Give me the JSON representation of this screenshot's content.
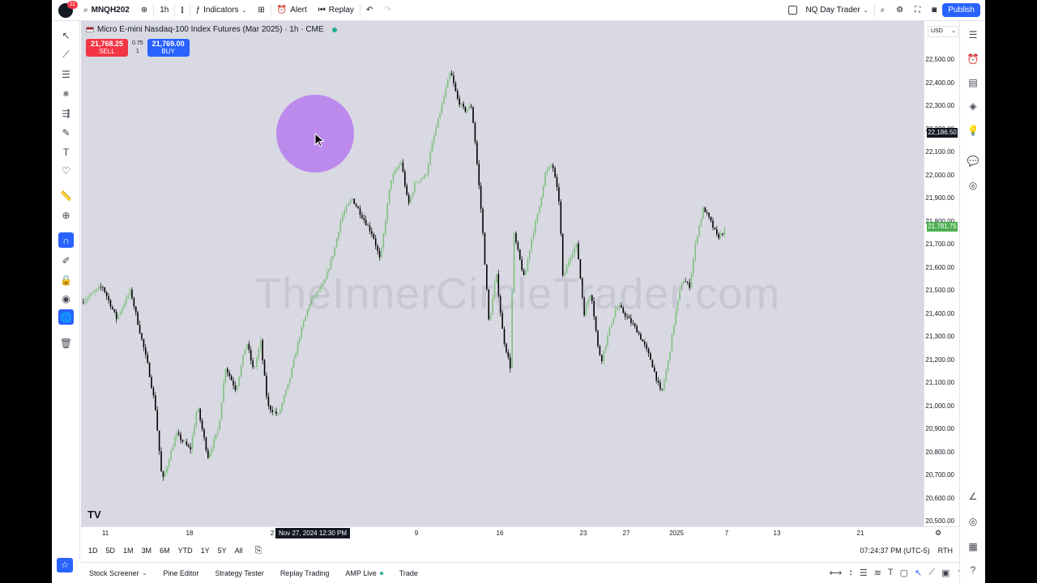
{
  "app": {
    "symbol": "MNQH202",
    "interval": "1h",
    "notifications": "11",
    "indicators_label": "Indicators",
    "alert_label": "Alert",
    "replay_label": "Replay",
    "layout_name": "NQ Day Trader",
    "publish_label": "Publish"
  },
  "chart": {
    "legend_title": "Micro E-mini Nasdaq-100 Index Futures (Mar 2025) · 1h · CME",
    "sell_price": "21,768.25",
    "sell_label": "SELL",
    "buy_price": "21,769.00",
    "buy_label": "BUY",
    "spread": "0.75",
    "quantity": "1",
    "watermark": "TheInnerCircleTrader.com",
    "currency": "USD",
    "crosshair_price": "22,186.50",
    "last_price": "21,781.75",
    "crosshair_time": "Nov 27, 2024    12:30 PM",
    "colors": {
      "up": "#7fbf7f",
      "down": "#000000",
      "last": "#4caf50",
      "sell": "#f23645",
      "buy": "#2962ff"
    }
  },
  "chart_data": {
    "type": "candlestick",
    "price_ticks": [
      "22,500.00",
      "22,400.00",
      "22,300.00",
      "22,200.00",
      "22,100.00",
      "22,000.00",
      "21,900.00",
      "21,800.00",
      "21,700.00",
      "21,600.00",
      "21,500.00",
      "21,400.00",
      "21,300.00",
      "21,200.00",
      "21,100.00",
      "21,000.00",
      "20,900.00",
      "20,800.00",
      "20,700.00",
      "20,600.00",
      "20,500.00"
    ],
    "time_ticks": [
      "11",
      "18",
      "2",
      "9",
      "16",
      "23",
      "27",
      "2025",
      "7",
      "13",
      "21"
    ],
    "ylim": [
      20500,
      22560
    ],
    "path": [
      [
        0,
        21450
      ],
      [
        6,
        21520
      ],
      [
        10,
        21380
      ],
      [
        14,
        21500
      ],
      [
        17,
        21300
      ],
      [
        19,
        21170
      ],
      [
        21,
        21000
      ],
      [
        23,
        20670
      ],
      [
        27,
        20880
      ],
      [
        31,
        20810
      ],
      [
        33,
        21000
      ],
      [
        36,
        20780
      ],
      [
        39,
        20900
      ],
      [
        41,
        21170
      ],
      [
        44,
        21070
      ],
      [
        47,
        21280
      ],
      [
        49,
        21150
      ],
      [
        51,
        21280
      ],
      [
        53,
        21000
      ],
      [
        56,
        20960
      ],
      [
        59,
        21100
      ],
      [
        62,
        21300
      ],
      [
        65,
        21450
      ],
      [
        69,
        21530
      ],
      [
        72,
        21680
      ],
      [
        74,
        21820
      ],
      [
        77,
        21900
      ],
      [
        80,
        21820
      ],
      [
        83,
        21740
      ],
      [
        85,
        21630
      ],
      [
        88,
        21980
      ],
      [
        91,
        22060
      ],
      [
        93,
        21870
      ],
      [
        95,
        21970
      ],
      [
        98,
        22000
      ],
      [
        100,
        22150
      ],
      [
        103,
        22330
      ],
      [
        105,
        22450
      ],
      [
        107,
        22330
      ],
      [
        109,
        22280
      ],
      [
        111,
        22300
      ],
      [
        112,
        22150
      ],
      [
        114,
        21800
      ],
      [
        116,
        21350
      ],
      [
        118,
        21580
      ],
      [
        120,
        21300
      ],
      [
        122,
        21170
      ],
      [
        123,
        21750
      ],
      [
        126,
        21550
      ],
      [
        128,
        21720
      ],
      [
        130,
        21840
      ],
      [
        132,
        22010
      ],
      [
        134,
        22050
      ],
      [
        136,
        21880
      ],
      [
        137,
        21550
      ],
      [
        139,
        21650
      ],
      [
        141,
        21700
      ],
      [
        143,
        21400
      ],
      [
        145,
        21500
      ],
      [
        147,
        21250
      ],
      [
        148,
        21200
      ],
      [
        150,
        21320
      ],
      [
        152,
        21420
      ],
      [
        153,
        21430
      ],
      [
        156,
        21370
      ],
      [
        158,
        21330
      ],
      [
        160,
        21270
      ],
      [
        162,
        21200
      ],
      [
        165,
        21050
      ],
      [
        167,
        21200
      ],
      [
        169,
        21400
      ],
      [
        171,
        21550
      ],
      [
        173,
        21520
      ],
      [
        175,
        21730
      ],
      [
        177,
        21860
      ],
      [
        179,
        21800
      ],
      [
        181,
        21730
      ],
      [
        183,
        21760
      ]
    ]
  },
  "time_ranges": [
    "1D",
    "5D",
    "1M",
    "3M",
    "6M",
    "YTD",
    "1Y",
    "5Y",
    "All"
  ],
  "time_status": {
    "clock": "07:24:37 PM (UTC-5)",
    "session": "RTH"
  },
  "bottom_tabs": [
    "Stock Screener",
    "Pine Editor",
    "Strategy Tester",
    "Replay Trading",
    "AMP Live",
    "Trade"
  ]
}
